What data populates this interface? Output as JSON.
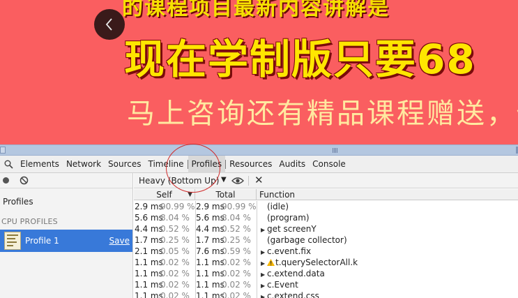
{
  "banner": {
    "top_text": "的课程项目最新内容讲解是",
    "headline": "现在学制版只要68",
    "subline": "马上咨询还有精品课程赠送，你还",
    "back_icon": "chevron-left-icon",
    "bg_color": "#fa5e60"
  },
  "devtools": {
    "tabs": [
      "Elements",
      "Network",
      "Sources",
      "Timeline",
      "Profiles",
      "Resources",
      "Audits",
      "Console"
    ],
    "selected_tab": "Profiles",
    "sidebar": {
      "title": "Profiles",
      "section": "CPU PROFILES",
      "profile_name": "Profile 1",
      "save_label": "Save"
    },
    "view_selector": "Heavy (Bottom Up)",
    "columns": {
      "self": "Self",
      "total": "Total",
      "function": "Function"
    },
    "rows": [
      {
        "self_ms": "2.9 ms",
        "self_pct": "90.99 %",
        "total_ms": "2.9 ms",
        "total_pct": "90.99 %",
        "fn": "(idle)",
        "expandable": false,
        "warning": false
      },
      {
        "self_ms": "5.6 ms",
        "self_pct": "8.04 %",
        "total_ms": "5.6 ms",
        "total_pct": "8.04 %",
        "fn": "(program)",
        "expandable": false,
        "warning": false
      },
      {
        "self_ms": "4.4 ms",
        "self_pct": "0.52 %",
        "total_ms": "4.4 ms",
        "total_pct": "0.52 %",
        "fn": "get screenY",
        "expandable": true,
        "warning": false
      },
      {
        "self_ms": "1.7 ms",
        "self_pct": "0.25 %",
        "total_ms": "1.7 ms",
        "total_pct": "0.25 %",
        "fn": "(garbage collector)",
        "expandable": false,
        "warning": false
      },
      {
        "self_ms": "2.1 ms",
        "self_pct": "0.05 %",
        "total_ms": "7.6 ms",
        "total_pct": "0.59 %",
        "fn": "c.event.fix",
        "expandable": true,
        "warning": false
      },
      {
        "self_ms": "1.1 ms",
        "self_pct": "0.02 %",
        "total_ms": "1.1 ms",
        "total_pct": "0.02 %",
        "fn": "t.querySelectorAll.k",
        "expandable": true,
        "warning": true
      },
      {
        "self_ms": "1.1 ms",
        "self_pct": "0.02 %",
        "total_ms": "1.1 ms",
        "total_pct": "0.02 %",
        "fn": "c.extend.data",
        "expandable": true,
        "warning": false
      },
      {
        "self_ms": "1.1 ms",
        "self_pct": "0.02 %",
        "total_ms": "1.1 ms",
        "total_pct": "0.02 %",
        "fn": "c.Event",
        "expandable": true,
        "warning": false
      },
      {
        "self_ms": "1.1 ms",
        "self_pct": "0.02 %",
        "total_ms": "1.1 ms",
        "total_pct": "0.02 %",
        "fn": "c.extend.css",
        "expandable": true,
        "warning": false
      }
    ]
  },
  "colors": {
    "selection": "#3879d9",
    "annotation_circle": "#d12c2c"
  }
}
